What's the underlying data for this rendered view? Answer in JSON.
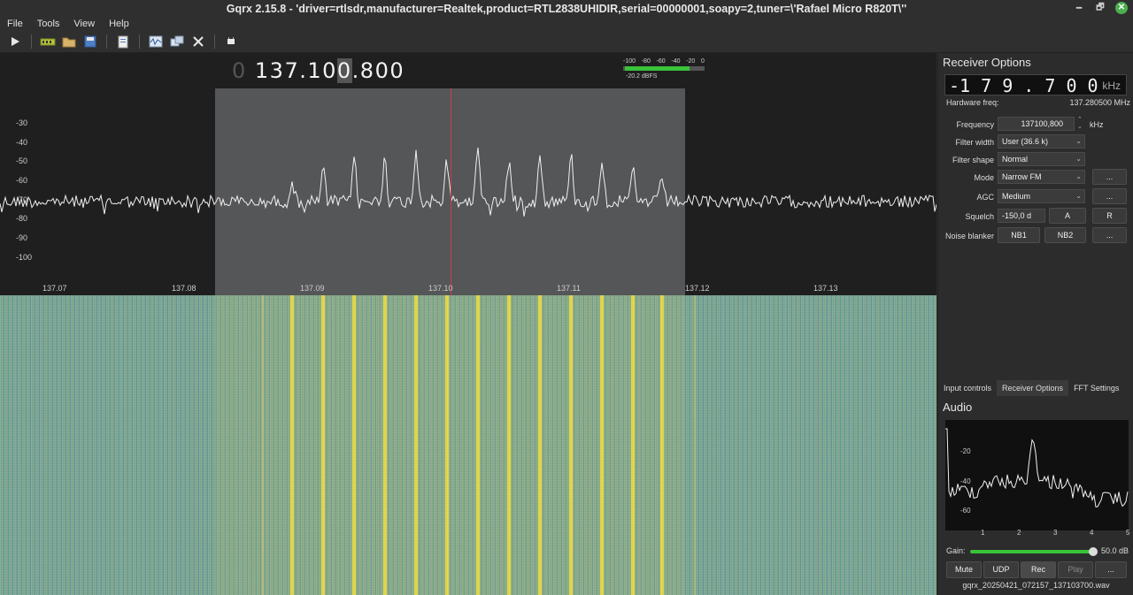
{
  "window": {
    "title": "Gqrx 2.15.8 - 'driver=rtlsdr,manufacturer=Realtek,product=RTL2838UHIDIR,serial=00000001,soapy=2,tuner=\\'Rafael Micro R820T\\''",
    "minimize": "🗕",
    "maximize": "🗗",
    "close": "✕"
  },
  "menu": {
    "file": "File",
    "tools": "Tools",
    "view": "View",
    "help": "Help"
  },
  "frequency_display": {
    "dim_prefix": "0 ",
    "part1": "137.10",
    "highlight": "0",
    "part2": ".800"
  },
  "meter": {
    "scale": [
      "-100",
      "-80",
      "-60",
      "-40",
      "-20",
      "0"
    ],
    "level_fraction": 0.83,
    "label": "-20.2 dBFS"
  },
  "spectrum": {
    "db_labels": [
      "-30",
      "-40",
      "-50",
      "-60",
      "-70",
      "-80",
      "-90",
      "-100"
    ],
    "freq_labels": [
      "137.07",
      "137.08",
      "137.09",
      "137.10",
      "137.11",
      "137.12",
      "137.13"
    ]
  },
  "receiver": {
    "title": "Receiver Options",
    "offset_display": "-1 7 9 . 7 0 0",
    "offset_unit": "kHz",
    "hw_freq_label": "Hardware freq:",
    "hw_freq_value": "137.280500 MHz",
    "frequency_label": "Frequency",
    "frequency_value": "137100,800",
    "frequency_unit": "kHz",
    "filter_width_label": "Filter width",
    "filter_width_value": "User (36.6 k)",
    "filter_shape_label": "Filter shape",
    "filter_shape_value": "Normal",
    "mode_label": "Mode",
    "mode_value": "Narrow FM",
    "mode_more": "...",
    "agc_label": "AGC",
    "agc_value": "Medium",
    "agc_more": "...",
    "squelch_label": "Squelch",
    "squelch_value": "-150,0 d",
    "squelch_a": "A",
    "squelch_r": "R",
    "nb_label": "Noise blanker",
    "nb1": "NB1",
    "nb2": "NB2",
    "nb_more": "..."
  },
  "tabs": [
    "Input controls",
    "Receiver Options",
    "FFT Settings"
  ],
  "audio": {
    "title": "Audio",
    "y_labels": [
      "-20",
      "-40",
      "-60"
    ],
    "x_labels": [
      "1",
      "2",
      "3",
      "4",
      "5"
    ],
    "gain_label": "Gain:",
    "gain_value": "50.0 dB",
    "gain_fraction": 1.0,
    "mute": "Mute",
    "udp": "UDP",
    "rec": "Rec",
    "play": "Play",
    "more": "...",
    "filename": "gqrx_20250421_072157_137103700.wav"
  }
}
